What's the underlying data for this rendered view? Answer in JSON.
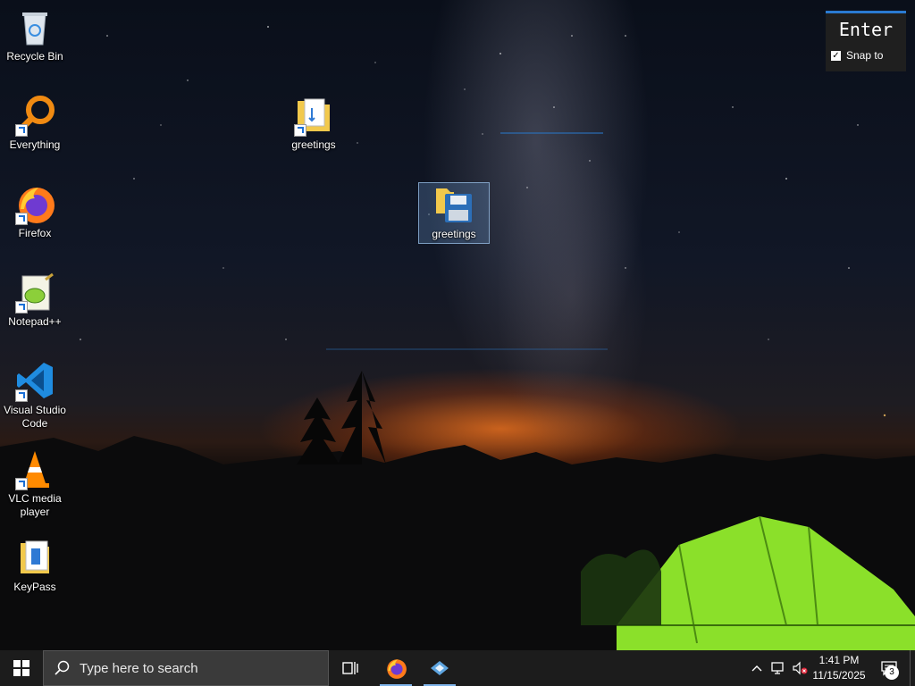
{
  "desktop": {
    "icons": [
      {
        "label": "Recycle Bin"
      },
      {
        "label": "Everything"
      },
      {
        "label": "Firefox"
      },
      {
        "label": "Notepad++"
      },
      {
        "label": "Visual Studio Code"
      },
      {
        "label": "VLC media player"
      },
      {
        "label": "KeyPass"
      },
      {
        "label": "greetings"
      },
      {
        "label": "greetings"
      }
    ]
  },
  "widget": {
    "key_label": "Enter",
    "snap_label": "Snap to",
    "snap_checked": true
  },
  "taskbar": {
    "search_placeholder": "Type here to search",
    "clock_time": "1:41 PM",
    "clock_date": "11/15/2025",
    "notification_count": "3"
  },
  "colors": {
    "taskbar": "#1c1c1c",
    "accent": "#2a7ad1",
    "tent_green": "#8be02a"
  }
}
